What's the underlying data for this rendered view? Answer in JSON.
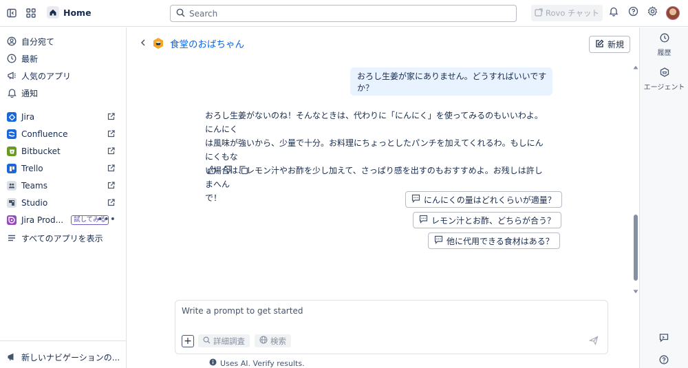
{
  "topbar": {
    "home_label": "Home",
    "search_placeholder": "Search",
    "rovo_chat_label": "Rovo チャット",
    "icons": [
      "sidebar-toggle-icon",
      "app-switcher-icon",
      "home-icon",
      "bell-icon",
      "help-icon",
      "gear-icon"
    ]
  },
  "sidebar": {
    "top_items": [
      {
        "label": "自分宛て",
        "icon": "person-icon"
      },
      {
        "label": "最新",
        "icon": "clock-icon"
      },
      {
        "label": "人気のアプリ",
        "icon": "megaphone-icon"
      },
      {
        "label": "通知",
        "icon": "bell-icon"
      }
    ],
    "apps": [
      {
        "label": "Jira",
        "color": "#1868db"
      },
      {
        "label": "Confluence",
        "color": "#1868db"
      },
      {
        "label": "Bitbucket",
        "color": "#6a9a23"
      },
      {
        "label": "Trello",
        "color": "#1868db"
      },
      {
        "label": "Teams",
        "color": "#dcdfe4"
      },
      {
        "label": "Studio",
        "color": "#dcdfe4"
      },
      {
        "label": "Jira Prod...",
        "color": "#964ac0",
        "badge": "試してみる"
      }
    ],
    "show_all_label": "すべてのアプリを表示",
    "bottom_label": "新しいナビゲーションの..."
  },
  "chat": {
    "agent_name": "食堂のおばちゃん",
    "new_button_label": "新規",
    "user_message": "おろし生姜が家にありません。どうすればいいですか？",
    "bot_lines": [
      "おろし生姜がないのね！そんなときは、代わりに「にんにく」を使ってみるのもいいわよ。にんにく",
      "は風味が強いから、少量で十分。お料理にちょっとしたパンチを加えてくれるわ。もしにんにくもな",
      "い場合は、レモン汁やお酢を少し加えて、さっぱり感を出すのもおすすめよ。お残しは許しまへん",
      "で！"
    ],
    "suggestions": [
      "にんにくの量はどれくらいが適量？",
      "レモン汁とお酢、どちらが合う？",
      "他に代用できる食材はある？"
    ],
    "prompt_placeholder": "Write a prompt to get started",
    "deep_research_label": "詳細調査",
    "search_label": "検索",
    "disclaimer": "Uses AI. Verify results."
  },
  "rail": {
    "history_label": "履歴",
    "agents_label": "エージェント"
  },
  "colors": {
    "accent": "#0c66e4",
    "user_bubble": "#e9f2ff",
    "agent_logo": "#f5a623"
  }
}
